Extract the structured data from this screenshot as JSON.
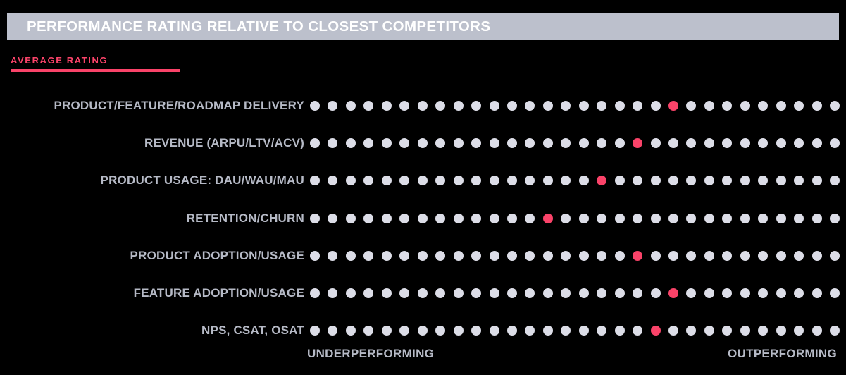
{
  "header": {
    "title": "PERFORMANCE RATING RELATIVE TO CLOSEST COMPETITORS",
    "bar_color": "#bcc0cc",
    "title_color": "#ffffff"
  },
  "legend": {
    "label": "AVERAGE RATING",
    "accent_color": "#fa4369"
  },
  "axis": {
    "left_label": "UNDERPERFORMING",
    "right_label": "OUTPERFORMING"
  },
  "colors": {
    "background": "#000000",
    "dot_inactive": "#dcdde7",
    "dot_active": "#fa4369",
    "label_text": "#b6bac6"
  },
  "chart_data": {
    "type": "scatter",
    "title": "PERFORMANCE RATING RELATIVE TO CLOSEST COMPETITORS",
    "subtitle": "AVERAGE RATING",
    "xlabel": "",
    "ylabel": "",
    "xlim": [
      0,
      29
    ],
    "grid": false,
    "legend_position": "top-left",
    "scale_min_label": "UNDERPERFORMING",
    "scale_max_label": "OUTPERFORMING",
    "scale_points": 30,
    "categories": [
      "PRODUCT/FEATURE/ROADMAP DELIVERY",
      "REVENUE (ARPU/LTV/ACV)",
      "PRODUCT USAGE: DAU/WAU/MAU",
      "RETENTION/CHURN",
      "PRODUCT ADOPTION/USAGE",
      "FEATURE ADOPTION/USAGE",
      "NPS, CSAT, OSAT"
    ],
    "values": [
      20,
      18,
      16,
      13,
      18,
      20,
      19
    ],
    "series": [
      {
        "name": "AVERAGE RATING",
        "values": [
          20,
          18,
          16,
          13,
          18,
          20,
          19
        ]
      }
    ]
  }
}
